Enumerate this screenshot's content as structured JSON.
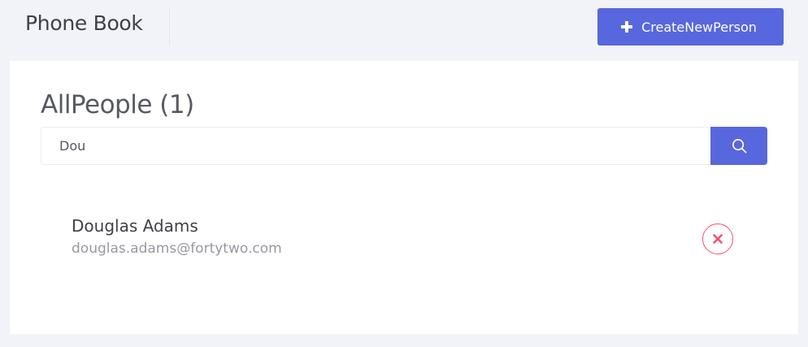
{
  "header": {
    "app_title": "Phone Book",
    "create_button_label": "CreateNewPerson"
  },
  "main": {
    "title": "AllPeople (1)",
    "search": {
      "value": "Dou",
      "placeholder": ""
    },
    "people": [
      {
        "name": "Douglas Adams",
        "email": "douglas.adams@fortytwo.com"
      }
    ]
  },
  "icons": {
    "create": "plus-icon",
    "search": "search-icon",
    "delete": "close-icon"
  },
  "colors": {
    "primary": "#5867dd",
    "danger": "#f4516c",
    "page_background": "#f2f3f8",
    "card_background": "#ffffff"
  }
}
